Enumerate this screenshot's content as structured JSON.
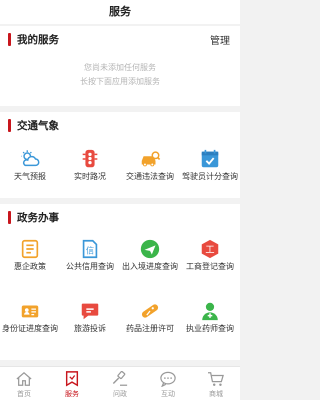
{
  "header": {
    "title": "服务"
  },
  "my_services": {
    "title": "我的服务",
    "manage_label": "管理",
    "empty_line1": "您尚未添加任何服务",
    "empty_line2": "长按下面应用添加服务"
  },
  "traffic": {
    "title": "交通气象",
    "items": [
      {
        "label": "天气预报",
        "icon": "weather-icon",
        "color": "#3a97d8"
      },
      {
        "label": "实时路况",
        "icon": "traffic-light-icon",
        "color": "#e84a3f"
      },
      {
        "label": "交通违法查询",
        "icon": "car-violation-icon",
        "color": "#f2a22b"
      },
      {
        "label": "驾驶员计分查询",
        "icon": "calendar-check-icon",
        "color": "#3a97d8"
      }
    ]
  },
  "gov": {
    "title": "政务办事",
    "items": [
      {
        "label": "惠企政策",
        "icon": "document-list-icon",
        "color": "#f2a22b"
      },
      {
        "label": "公共信用查询",
        "icon": "credit-icon",
        "color": "#3a97d8"
      },
      {
        "label": "出入境进度查询",
        "icon": "airplane-icon",
        "color": "#3bb54a"
      },
      {
        "label": "工商登记查询",
        "icon": "business-registration-icon",
        "color": "#e84a3f"
      },
      {
        "label": "身份证进度查询",
        "icon": "id-card-icon",
        "color": "#f2a22b"
      },
      {
        "label": "旅游投诉",
        "icon": "chat-bubble-icon",
        "color": "#e84a3f"
      },
      {
        "label": "药品注册许可",
        "icon": "pill-icon",
        "color": "#f2a22b"
      },
      {
        "label": "执业药师查询",
        "icon": "pharmacist-icon",
        "color": "#3bb54a"
      }
    ]
  },
  "tabbar": {
    "items": [
      {
        "label": "首页",
        "icon": "home-icon"
      },
      {
        "label": "服务",
        "icon": "service-icon",
        "active": true
      },
      {
        "label": "问政",
        "icon": "gavel-icon"
      },
      {
        "label": "互动",
        "icon": "chat-icon"
      },
      {
        "label": "商城",
        "icon": "cart-icon"
      }
    ]
  },
  "colors": {
    "accent": "#c8161d",
    "blue": "#3a97d8",
    "orange": "#f2a22b",
    "red": "#e84a3f",
    "green": "#3bb54a"
  }
}
